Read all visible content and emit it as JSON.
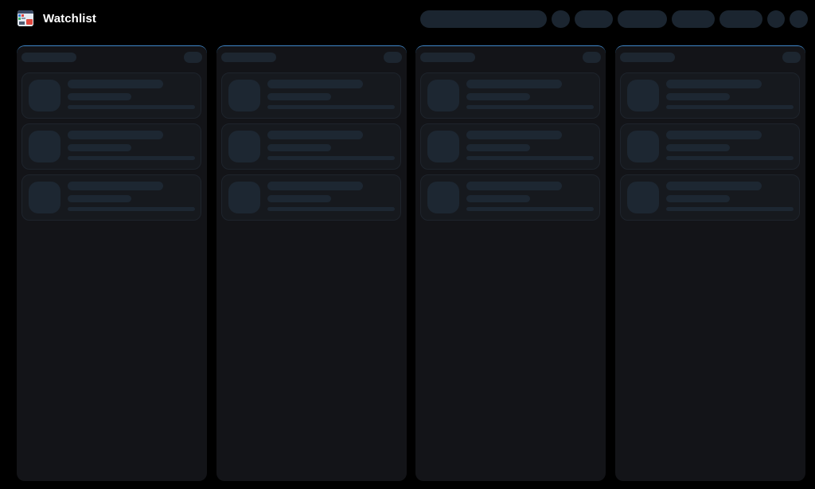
{
  "app": {
    "title": "Watchlist",
    "logo_icon": "watchlist-app-icon"
  },
  "header": {
    "controls": [
      {
        "name": "search-input-placeholder",
        "state": "loading"
      },
      {
        "name": "header-action-1",
        "state": "loading"
      },
      {
        "name": "header-action-2",
        "state": "loading"
      },
      {
        "name": "header-action-3",
        "state": "loading"
      },
      {
        "name": "header-action-4",
        "state": "loading"
      },
      {
        "name": "header-action-5",
        "state": "loading"
      },
      {
        "name": "header-action-6",
        "state": "loading"
      },
      {
        "name": "header-action-7",
        "state": "loading"
      }
    ]
  },
  "board": {
    "state": "loading",
    "columns": [
      {
        "cards": 3
      },
      {
        "cards": 3
      },
      {
        "cards": 3
      },
      {
        "cards": 3
      }
    ]
  },
  "colors": {
    "background": "#000000",
    "column": "#131418",
    "column_accent": "#3f86c7",
    "skeleton": "#1b2530",
    "title_text": "#ffffff"
  }
}
